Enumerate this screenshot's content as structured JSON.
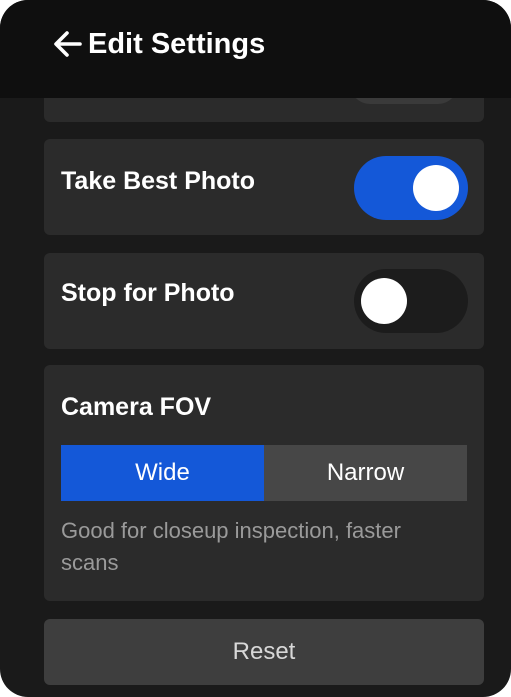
{
  "header": {
    "back_icon": "arrow-left-icon",
    "title": "Edit Settings"
  },
  "settings": {
    "take_best_photo": {
      "label": "Take Best Photo",
      "enabled": true
    },
    "stop_for_photo": {
      "label": "Stop for Photo",
      "enabled": false
    },
    "camera_fov": {
      "label": "Camera FOV",
      "options": [
        "Wide",
        "Narrow"
      ],
      "selected": "Wide",
      "description": "Good for closeup inspection, faster scans"
    }
  },
  "actions": {
    "reset_label": "Reset"
  },
  "colors": {
    "accent": "#1458d8",
    "background": "#1a1a1a",
    "card": "#2b2b2b",
    "header": "#0f0f0f"
  }
}
